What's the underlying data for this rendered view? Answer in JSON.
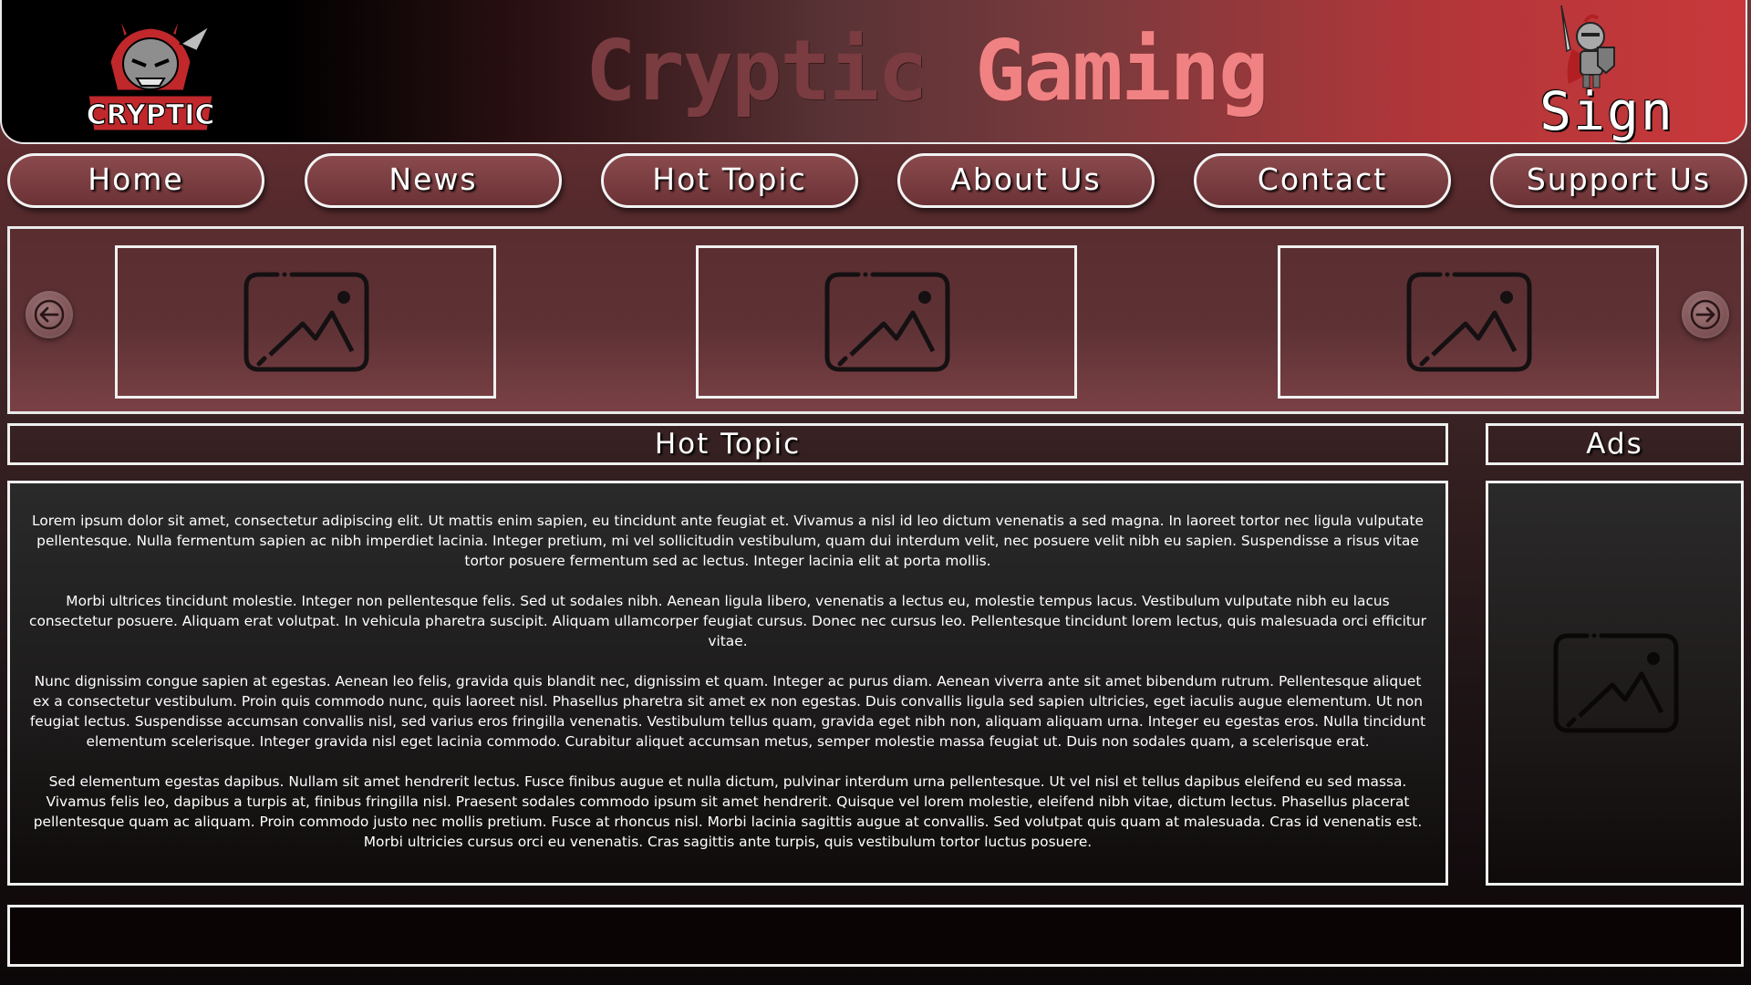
{
  "header": {
    "title_word1": "Cryptic",
    "title_word2": "Gaming",
    "logo_text": "CRYPTIC",
    "sign_in_label": "Sign In"
  },
  "nav": {
    "items": [
      {
        "label": "Home"
      },
      {
        "label": "News"
      },
      {
        "label": "Hot Topic"
      },
      {
        "label": "About Us"
      },
      {
        "label": "Contact"
      },
      {
        "label": "Support Us"
      }
    ]
  },
  "carousel": {
    "slides": [
      {
        "icon": "image-placeholder-icon"
      },
      {
        "icon": "image-placeholder-icon"
      },
      {
        "icon": "image-placeholder-icon"
      }
    ],
    "prev_icon": "arrow-left-icon",
    "next_icon": "arrow-right-icon"
  },
  "hot_topic": {
    "title": "Hot Topic",
    "paragraphs": [
      "Lorem ipsum dolor sit amet, consectetur adipiscing elit. Ut mattis enim sapien, eu tincidunt ante feugiat et. Vivamus a nisl id leo dictum venenatis a sed magna. In laoreet tortor nec ligula vulputate pellentesque. Nulla fermentum sapien ac nibh imperdiet lacinia. Integer pretium, mi vel sollicitudin vestibulum, quam dui interdum velit, nec posuere velit nibh eu sapien. Suspendisse a risus vitae tortor posuere fermentum sed ac lectus. Integer lacinia elit at porta mollis.",
      "Morbi ultrices tincidunt molestie. Integer non pellentesque felis. Sed ut sodales nibh. Aenean ligula libero, venenatis a lectus eu, molestie tempus lacus. Vestibulum vulputate nibh eu lacus consectetur posuere. Aliquam erat volutpat. In vehicula pharetra suscipit. Aliquam ullamcorper feugiat cursus. Donec nec cursus leo. Pellentesque tincidunt lorem lectus, quis malesuada orci efficitur vitae.",
      "Nunc dignissim congue sapien at egestas. Aenean leo felis, gravida quis blandit nec, dignissim et quam. Integer ac purus diam. Aenean viverra ante sit amet bibendum rutrum. Pellentesque aliquet ex a consectetur vestibulum. Proin quis commodo nunc, quis laoreet nisl. Phasellus pharetra sit amet ex non egestas. Duis convallis ligula sed sapien ultricies, eget iaculis augue elementum. Ut non feugiat lectus. Suspendisse accumsan convallis nisl, sed varius eros fringilla venenatis. Vestibulum tellus quam, gravida eget nibh non, aliquam aliquam urna. Integer eu egestas eros. Nulla tincidunt elementum scelerisque. Integer gravida nisl eget lacinia commodo. Curabitur aliquet accumsan metus, semper molestie massa feugiat ut. Duis non sodales quam, a scelerisque erat.",
      "Sed elementum egestas dapibus. Nullam sit amet hendrerit lectus. Fusce finibus augue et nulla dictum, pulvinar interdum urna pellentesque. Ut vel nisl et tellus dapibus eleifend eu sed massa. Vivamus felis leo, dapibus a turpis at, finibus fringilla nisl. Praesent sodales commodo ipsum sit amet hendrerit. Quisque vel lorem molestie, eleifend nibh vitae, dictum lectus. Phasellus placerat pellentesque quam ac aliquam. Proin commodo justo nec mollis pretium. Fusce at rhoncus nisl. Morbi lacinia sagittis augue at convallis. Sed volutpat quis quam at malesuada. Cras id venenatis est. Morbi ultricies cursus orci eu venenatis. Cras sagittis ante turpis, quis vestibulum tortor luctus posuere."
    ]
  },
  "ads": {
    "title": "Ads",
    "icon": "image-placeholder-icon"
  },
  "colors": {
    "accent_red": "#c8383b",
    "title_dark": "#7a3c40",
    "title_light": "#f08283",
    "border": "#efefef"
  }
}
